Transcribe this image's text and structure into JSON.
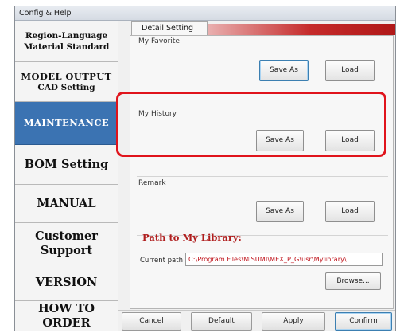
{
  "window": {
    "title": "Config & Help"
  },
  "sidebar": {
    "items": [
      {
        "line1": "Region-Language",
        "line2": "Material Standard"
      },
      {
        "line1": "MODEL OUTPUT",
        "line2": "CAD Setting"
      },
      {
        "label": "MAINTENANCE"
      },
      {
        "label": "BOM Setting"
      },
      {
        "label": "MANUAL"
      },
      {
        "line1": "Customer",
        "line2": "Support"
      },
      {
        "label": "VERSION"
      },
      {
        "label": "HOW TO ORDER"
      }
    ]
  },
  "tab": {
    "label": "Detail Setting"
  },
  "groups": {
    "favorite": {
      "label": "My Favorite",
      "save": "Save As",
      "load": "Load"
    },
    "history": {
      "label": "My History",
      "save": "Save As",
      "load": "Load"
    },
    "remark": {
      "label": "Remark",
      "save": "Save As",
      "load": "Load"
    }
  },
  "library": {
    "title": "Path to My Library:",
    "current_label": "Current path:",
    "current_value": "C:\\Program Files\\MISUMI\\MEX_P_G\\usr\\Mylibrary\\",
    "browse": "Browse..."
  },
  "footer": {
    "cancel": "Cancel",
    "default": "Default",
    "apply": "Apply",
    "confirm": "Confirm"
  },
  "colors": {
    "active_nav": "#3b73b2",
    "highlight": "#e0141c",
    "path_text": "#c0141c"
  }
}
